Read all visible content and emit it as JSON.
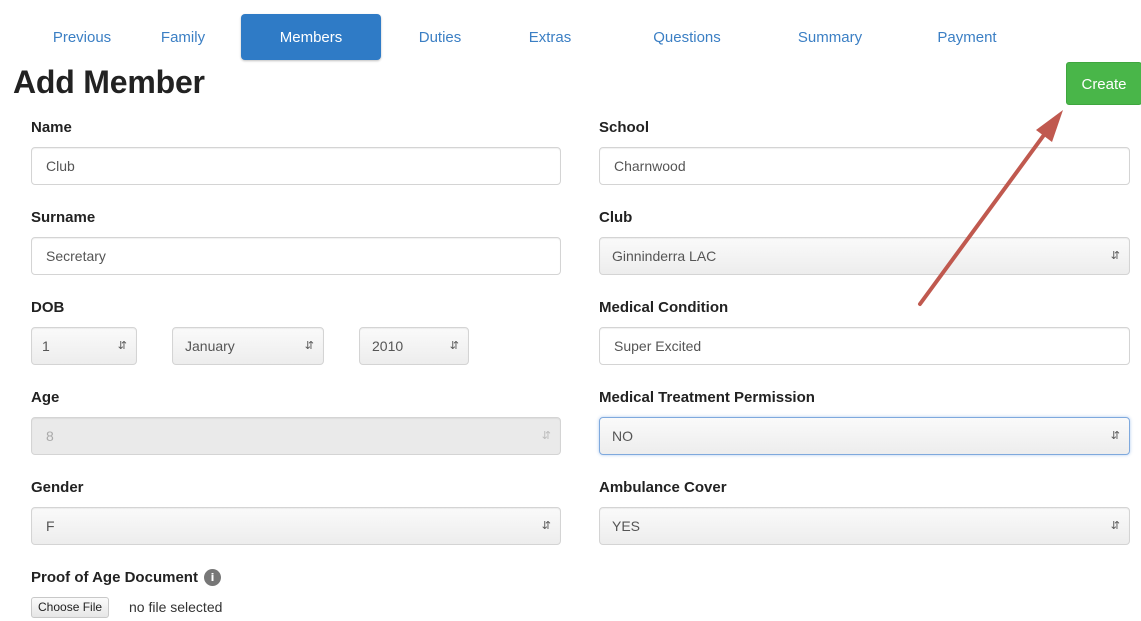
{
  "nav": {
    "tabs": [
      {
        "label": "Previous"
      },
      {
        "label": "Family"
      },
      {
        "label": "Members"
      },
      {
        "label": "Duties"
      },
      {
        "label": "Extras"
      },
      {
        "label": "Questions"
      },
      {
        "label": "Summary"
      },
      {
        "label": "Payment"
      }
    ],
    "active_tab": "Members"
  },
  "page": {
    "title": "Add Member",
    "create_label": "Create"
  },
  "form": {
    "name": {
      "label": "Name",
      "value": "Club"
    },
    "surname": {
      "label": "Surname",
      "value": "Secretary"
    },
    "dob": {
      "label": "DOB",
      "day": "1",
      "month": "January",
      "year": "2010"
    },
    "age": {
      "label": "Age",
      "value": "8"
    },
    "gender": {
      "label": "Gender",
      "value": "F"
    },
    "proof_of_age": {
      "label": "Proof of Age Document",
      "button": "Choose File",
      "status": "no file selected"
    },
    "school": {
      "label": "School",
      "value": "Charnwood"
    },
    "club": {
      "label": "Club",
      "value": "Ginninderra LAC"
    },
    "medical_condition": {
      "label": "Medical Condition",
      "value": "Super Excited"
    },
    "medical_permission": {
      "label": "Medical Treatment Permission",
      "value": "NO"
    },
    "ambulance_cover": {
      "label": "Ambulance Cover",
      "value": "YES"
    }
  },
  "colors": {
    "tab_active": "#2f7bc6",
    "tab_text": "#3b7fc4",
    "create_button": "#49b649",
    "annotation_arrow": "#c0594f"
  }
}
